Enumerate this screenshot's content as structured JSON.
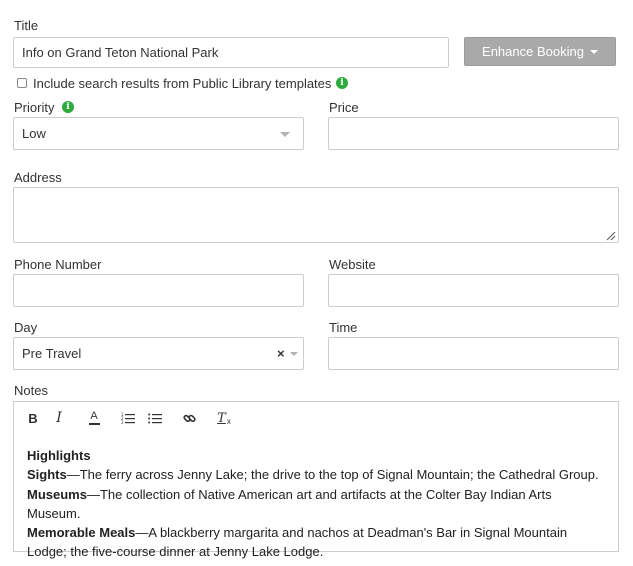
{
  "title_field": {
    "label": "Title",
    "value": "Info on Grand Teton National Park"
  },
  "enhance_button": {
    "label": "Enhance Booking"
  },
  "search_option": {
    "label": "Include search results from Public Library templates",
    "checked": false
  },
  "priority": {
    "label": "Priority",
    "value": "Low"
  },
  "price": {
    "label": "Price",
    "value": ""
  },
  "address": {
    "label": "Address",
    "value": ""
  },
  "phone": {
    "label": "Phone Number",
    "value": ""
  },
  "website": {
    "label": "Website",
    "value": ""
  },
  "day": {
    "label": "Day",
    "value": "Pre Travel",
    "clear_glyph": "×"
  },
  "time": {
    "label": "Time",
    "value": ""
  },
  "notes": {
    "label": "Notes",
    "toolbar": [
      {
        "icon": "bold-icon",
        "glyph": "B"
      },
      {
        "icon": "italic-icon",
        "glyph": "I"
      },
      {
        "icon": "text-color-icon",
        "glyph": "A"
      },
      {
        "icon": "ordered-list-icon",
        "glyph": ""
      },
      {
        "icon": "bullet-list-icon",
        "glyph": ""
      },
      {
        "icon": "link-icon",
        "glyph": ""
      },
      {
        "icon": "clear-format-icon",
        "glyph": "T"
      }
    ],
    "content": {
      "heading": "Highlights",
      "lines": [
        {
          "bold": "Sights",
          "text": "—The ferry across Jenny Lake; the drive to the top of Signal Mountain; the Cathedral Group."
        },
        {
          "bold": "Museums",
          "text": "—The collection of Native American art and artifacts at the Colter Bay Indian Arts Museum."
        },
        {
          "bold": "Memorable Meals",
          "text": "—A blackberry margarita and nachos at Deadman's Bar in Signal Mountain Lodge; the five-course dinner at Jenny Lake Lodge."
        }
      ]
    }
  },
  "colors": {
    "info_icon": "#2eaa3f",
    "button_bg": "#a9a9a9",
    "border": "#cccccc"
  }
}
